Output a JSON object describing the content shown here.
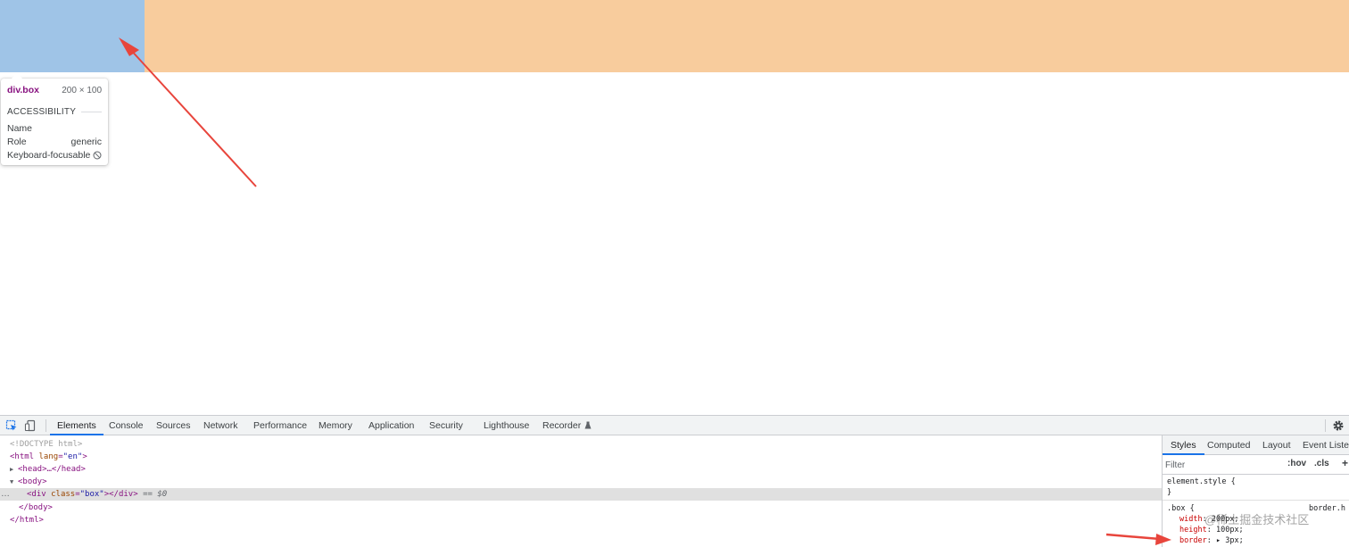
{
  "tooltip": {
    "tag": "div.box",
    "size": "200 × 100",
    "section": "ACCESSIBILITY",
    "rows": [
      {
        "label": "Name",
        "value": ""
      },
      {
        "label": "Role",
        "value": "generic"
      },
      {
        "label": "Keyboard-focusable",
        "value": ""
      }
    ]
  },
  "devtools": {
    "tabs": [
      "Elements",
      "Console",
      "Sources",
      "Network",
      "Performance",
      "Memory",
      "Application",
      "Security",
      "Lighthouse",
      "Recorder"
    ],
    "active_tab": "Elements",
    "dom": {
      "doctype": "<!DOCTYPE html>",
      "html_open_tag": "<html",
      "html_attr_name": "lang",
      "html_attr_value": "\"en\"",
      "html_close_bracket": ">",
      "head": "<head>…</head>",
      "body_open": "<body>",
      "div_open": "<div",
      "div_attr_name": "class",
      "div_attr_value": "\"box\"",
      "div_close": "></div>",
      "selected_marker": "== $0",
      "body_close": "</body>",
      "html_close": "</html>",
      "dots": "…"
    },
    "sidebar": {
      "tabs": [
        "Styles",
        "Computed",
        "Layout",
        "Event Listeners"
      ],
      "active_tab": "Styles",
      "filter_placeholder": "Filter",
      "hov": ":hov",
      "cls": ".cls",
      "plus": "+",
      "element_style": "element.style {",
      "close_brace": "}",
      "box_selector": ".box {",
      "source_link": "border.h",
      "props": [
        {
          "name": "width",
          "value": "200px;"
        },
        {
          "name": "height",
          "value": "100px;"
        },
        {
          "name": "border",
          "value": "3px;"
        }
      ]
    }
  },
  "watermark": "@稀土掘金技术社区",
  "colors": {
    "content_box": "#9fc4e7",
    "border_box": "#f8cc9d",
    "annotation_arrow": "#e8453c",
    "tab_underline": "#1a73e8"
  }
}
